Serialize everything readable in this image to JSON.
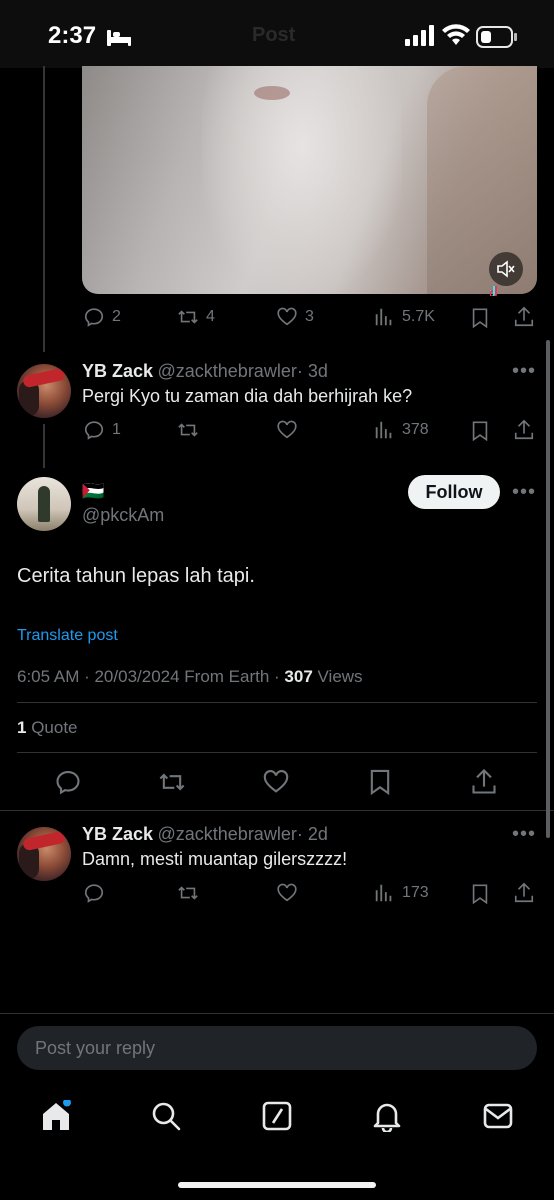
{
  "status": {
    "time": "2:37",
    "faded_title": "Post"
  },
  "tweet1": {
    "actions": {
      "replies": "2",
      "reposts": "4",
      "likes": "3",
      "views": "5.7K"
    }
  },
  "reply1": {
    "name": "YB Zack",
    "handle": "@zackthebrawler",
    "time": "· 3d",
    "text": "Pergi Kyo tu zaman dia dah berhijrah ke?",
    "replies": "1",
    "views": "378"
  },
  "main": {
    "flag": "🇵🇸",
    "handle": "@pkckAm",
    "follow_label": "Follow",
    "text": "Cerita tahun lepas lah tapi.",
    "translate_label": "Translate post",
    "timestamp": "6:05 AM · 20/03/2024 From Earth · ",
    "views_count": "307",
    "views_label": " Views",
    "quote_count": "1",
    "quote_label": " Quote"
  },
  "reply2": {
    "name": "YB Zack",
    "handle": "@zackthebrawler",
    "time": "· 2d",
    "text": "Damn, mesti muantap gilerszzzz!",
    "views": "173"
  },
  "reply_box": {
    "placeholder": "Post your reply"
  },
  "colors": {
    "accent": "#1d9bf0",
    "muted": "#71767b",
    "background": "#000000"
  }
}
